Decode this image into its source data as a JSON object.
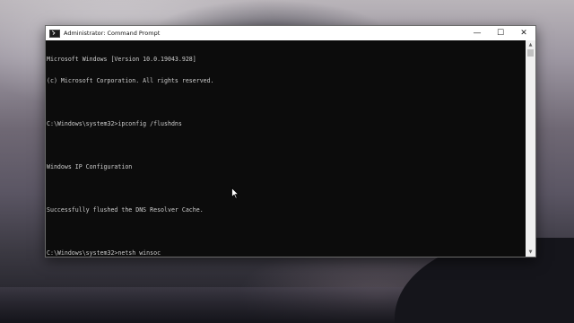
{
  "window": {
    "title": "Administrator: Command Prompt",
    "controls": {
      "minimize": "—",
      "maximize": "☐",
      "close": "✕"
    }
  },
  "console": {
    "lines": [
      "Microsoft Windows [Version 10.0.19043.928]",
      "(c) Microsoft Corporation. All rights reserved.",
      "",
      "C:\\Windows\\system32>ipconfig /flushdns",
      "",
      "Windows IP Configuration",
      "",
      "Successfully flushed the DNS Resolver Cache.",
      "",
      "C:\\Windows\\system32>netsh winsoc"
    ]
  },
  "icons": {
    "app": "console-icon",
    "cursor": "mouse-pointer-icon",
    "scroll_up": "▲",
    "scroll_down": "▼"
  },
  "colors": {
    "console_bg": "#0c0c0c",
    "console_text": "#cccccc",
    "titlebar_bg": "#ffffff"
  }
}
